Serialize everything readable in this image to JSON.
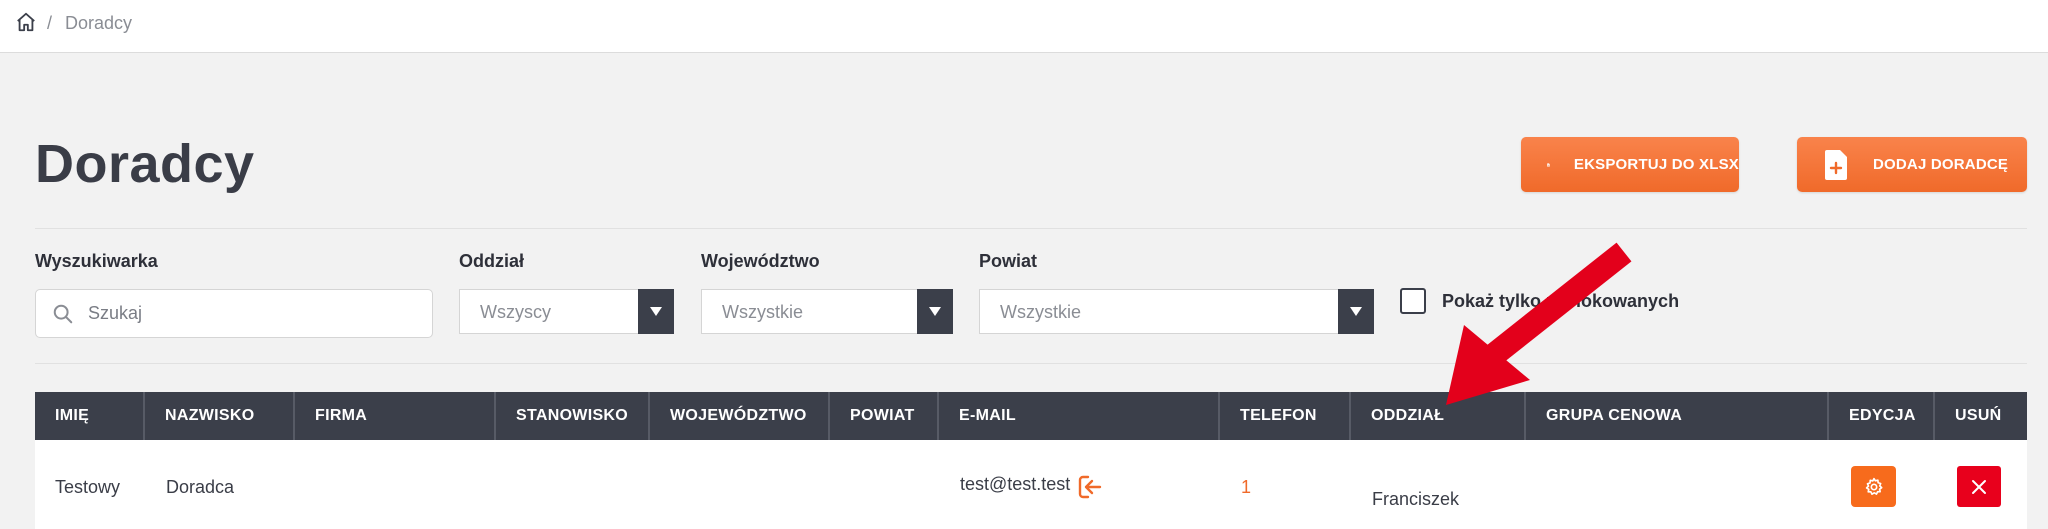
{
  "breadcrumb": {
    "separator": "/",
    "current": "Doradcy"
  },
  "page": {
    "title": "Doradcy"
  },
  "actions": {
    "export_label": "EKSPORTUJ DO XLSX",
    "add_label": "DODAJ DORADCĘ"
  },
  "filters": {
    "search": {
      "label": "Wyszukiwarka",
      "placeholder": "Szukaj"
    },
    "branch": {
      "label": "Oddział",
      "value": "Wszyscy"
    },
    "voivodeship": {
      "label": "Województwo",
      "value": "Wszystkie"
    },
    "district": {
      "label": "Powiat",
      "value": "Wszystkie"
    },
    "checkbox": {
      "label": "Pokaż tylko zablokowanych",
      "checked": false
    }
  },
  "table": {
    "columns": [
      "IMIĘ",
      "NAZWISKO",
      "FIRMA",
      "STANOWISKO",
      "WOJEWÓDZTWO",
      "POWIAT",
      "E-MAIL",
      "TELEFON",
      "ODDZIAŁ",
      "GRUPA CENOWA",
      "EDYCJA",
      "USUŃ"
    ],
    "rows": [
      {
        "first_name": "Testowy",
        "last_name": "Doradca",
        "company": "",
        "position": "",
        "voivodeship": "",
        "district": "",
        "email": "test@test.test",
        "phone": "1",
        "branch": "Franciszek",
        "price_group": ""
      }
    ]
  },
  "colors": {
    "accent": "#f06a2a",
    "header": "#3b3f4a",
    "delete": "#e8001c",
    "annotation": "#e3001b"
  },
  "icons": [
    "home-icon",
    "file-download-icon",
    "file-add-icon",
    "search-icon",
    "chevron-down-icon",
    "login-icon",
    "gear-icon",
    "close-icon",
    "annotation-arrow"
  ]
}
